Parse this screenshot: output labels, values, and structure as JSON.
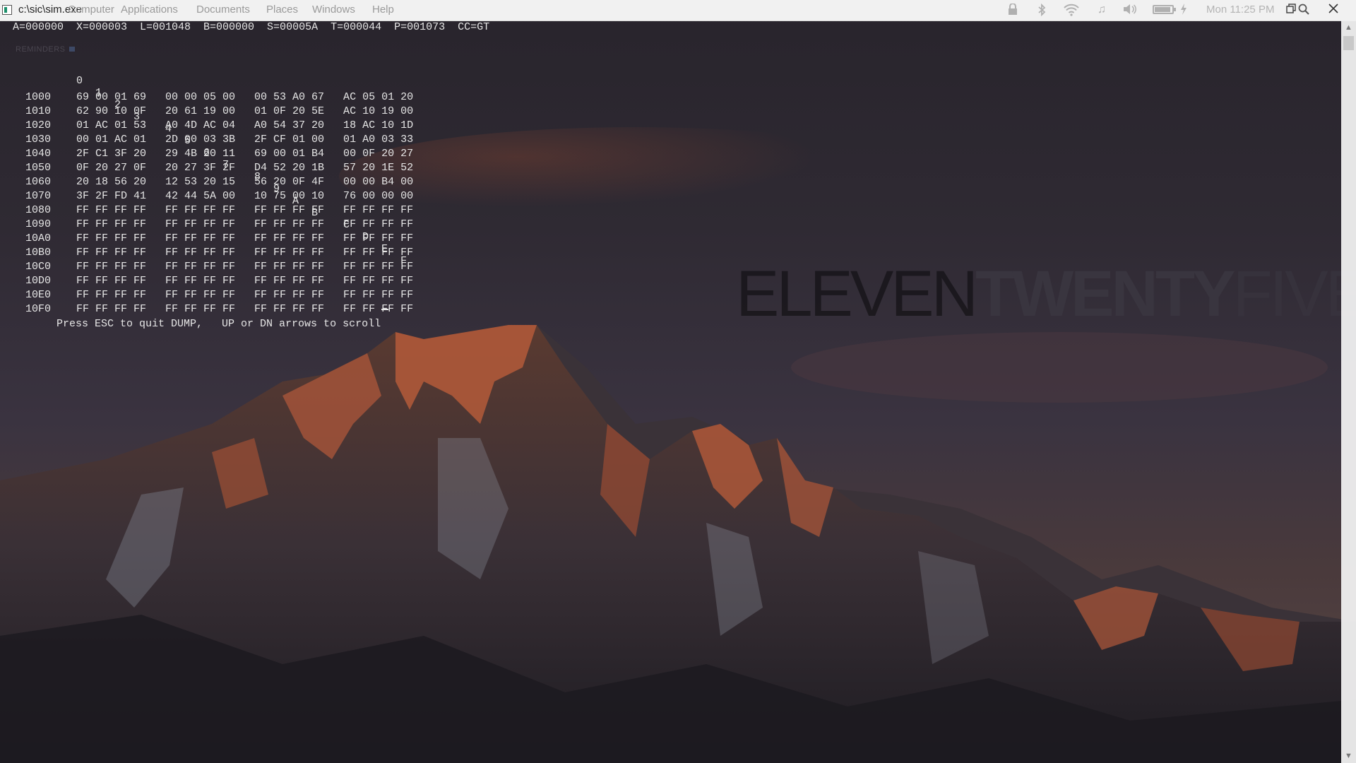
{
  "window": {
    "title": "c:\\sic\\sim.exe"
  },
  "menubar": {
    "items": [
      {
        "label": "Computer"
      },
      {
        "label": "Applications"
      },
      {
        "label": "Documents"
      },
      {
        "label": "Places"
      },
      {
        "label": "Windows"
      },
      {
        "label": "Help"
      }
    ],
    "status_icons": [
      "lock-icon",
      "bluetooth-icon",
      "wifi-icon",
      "music-icon",
      "volume-icon",
      "battery-icon",
      "charging-icon",
      "restore-window-icon",
      "search-icon",
      "close-icon"
    ],
    "clock": "Mon 11:25 PM"
  },
  "terminal": {
    "registers": "A=000000  X=000003  L=001048  B=000000  S=00005A  T=000044  P=001073  CC=GT",
    "reminders_label": "REMINDERS",
    "columns": [
      "0",
      "1",
      "2",
      "3",
      "4",
      "5",
      "6",
      "7",
      "8",
      "9",
      "A",
      "B",
      "C",
      "D",
      "E",
      "F"
    ],
    "rows": [
      {
        "addr": "1000",
        "bytes": "69 00 01 69   00 00 05 00   00 53 A0 67   AC 05 01 20"
      },
      {
        "addr": "1010",
        "bytes": "62 90 10 0F   20 61 19 00   01 0F 20 5E   AC 10 19 00"
      },
      {
        "addr": "1020",
        "bytes": "01 AC 01 53   A0 4D AC 04   A0 54 37 20   18 AC 10 1D"
      },
      {
        "addr": "1030",
        "bytes": "00 01 AC 01   2D 00 03 3B   2F CF 01 00   01 A0 03 33"
      },
      {
        "addr": "1040",
        "bytes": "2F C1 3F 20   29 4B 20 11   69 00 01 B4   00 0F 20 27"
      },
      {
        "addr": "1050",
        "bytes": "0F 20 27 0F   20 27 3F 2F   D4 52 20 1B   57 20 1E 52"
      },
      {
        "addr": "1060",
        "bytes": "20 18 56 20   12 53 20 15   56 20 0F 4F   00 00 B4 00"
      },
      {
        "addr": "1070",
        "bytes": "3F 2F FD 41   42 44 5A 00   10 75 00 10   76 00 00 00"
      },
      {
        "addr": "1080",
        "bytes": "FF FF FF FF   FF FF FF FF   FF FF FF FF   FF FF FF FF"
      },
      {
        "addr": "1090",
        "bytes": "FF FF FF FF   FF FF FF FF   FF FF FF FF   FF FF FF FF"
      },
      {
        "addr": "10A0",
        "bytes": "FF FF FF FF   FF FF FF FF   FF FF FF FF   FF FF FF FF"
      },
      {
        "addr": "10B0",
        "bytes": "FF FF FF FF   FF FF FF FF   FF FF FF FF   FF FF FF FF"
      },
      {
        "addr": "10C0",
        "bytes": "FF FF FF FF   FF FF FF FF   FF FF FF FF   FF FF FF FF"
      },
      {
        "addr": "10D0",
        "bytes": "FF FF FF FF   FF FF FF FF   FF FF FF FF   FF FF FF FF"
      },
      {
        "addr": "10E0",
        "bytes": "FF FF FF FF   FF FF FF FF   FF FF FF FF   FF FF FF FF"
      },
      {
        "addr": "10F0",
        "bytes": "FF FF FF FF   FF FF FF FF   FF FF FF FF   FF FF FF FF"
      }
    ],
    "prompt": "Press ESC to quit DUMP,   UP or DN arrows to scroll"
  },
  "logo": {
    "part1": "ELEVEN",
    "part2": "TWENTY",
    "part3": "FIVE"
  },
  "colors": {
    "terminal_text": "#e6e6e6",
    "sky": "#3a3340",
    "peak_light": "#c05a35"
  }
}
